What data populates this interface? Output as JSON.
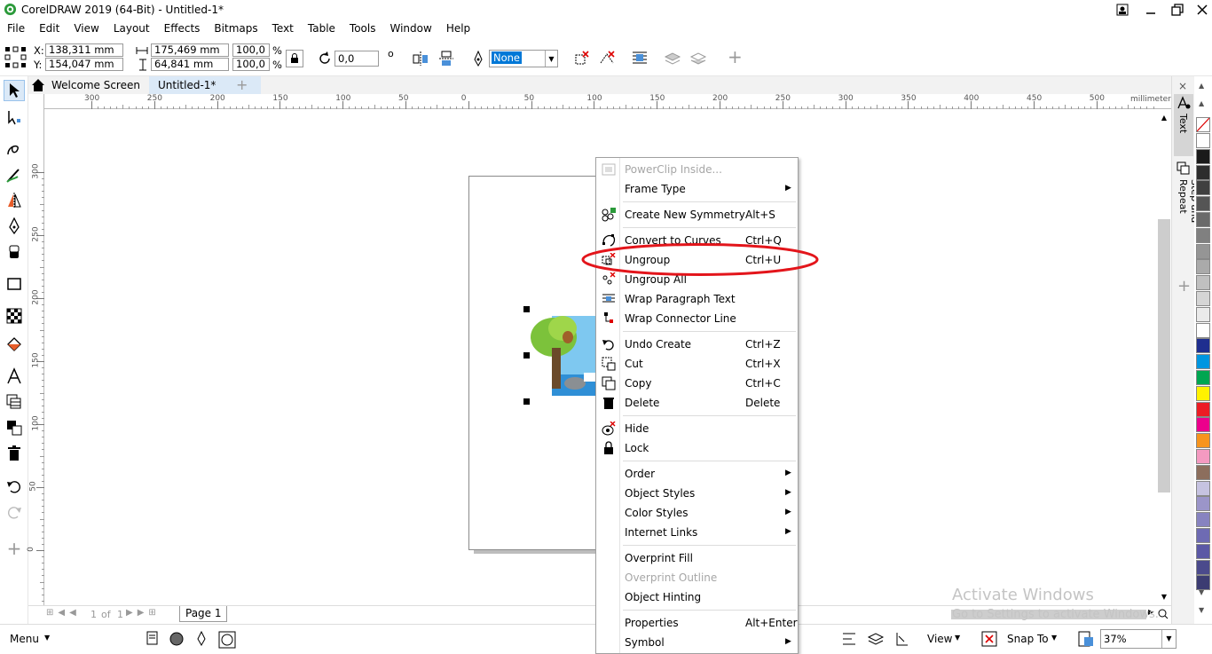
{
  "title_bar": {
    "title": "CorelDRAW 2019 (64-Bit) - Untitled-1*"
  },
  "menu": [
    "File",
    "Edit",
    "View",
    "Layout",
    "Effects",
    "Bitmaps",
    "Text",
    "Table",
    "Tools",
    "Window",
    "Help"
  ],
  "property_bar": {
    "x_label": "X:",
    "x_value": "138,311 mm",
    "y_label": "Y:",
    "y_value": "154,047 mm",
    "width_value": "175,469 mm",
    "height_value": "64,841 mm",
    "scale_x": "100,0",
    "scale_y": "100,0",
    "percent": "%",
    "rotation_value": "0,0",
    "degree": "o",
    "outline_value": "None"
  },
  "tabs": {
    "welcome": "Welcome Screen",
    "document": "Untitled-1*",
    "add": "+"
  },
  "rulers": {
    "h_ticks": [
      "300",
      "250",
      "200",
      "150",
      "100",
      "50",
      "0",
      "50",
      "100",
      "150",
      "200",
      "250",
      "300",
      "350",
      "400",
      "450",
      "500"
    ],
    "h_unit": "millimeters",
    "v_ticks": [
      "300",
      "250",
      "200",
      "150",
      "100",
      "50",
      "0"
    ]
  },
  "docker": {
    "text_tab": "Text",
    "step_tab": "Step and Repeat"
  },
  "palette_colors": [
    "#ffffff",
    "#1a1a1a",
    "#2d2d2d",
    "#404040",
    "#555555",
    "#6a6a6a",
    "#808080",
    "#959595",
    "#aaaaaa",
    "#c0c0c0",
    "#d5d5d5",
    "#eaeaea",
    "#ffffff",
    "#1f2e8f",
    "#0096e0",
    "#00a651",
    "#fff200",
    "#ec1c24",
    "#ec008c",
    "#f7941d",
    "#f49ac1",
    "#8c6e5d",
    "#c6c3e1",
    "#9b95c9",
    "#8783c0",
    "#6e6bb3",
    "#5b58a5",
    "#4b4a8c",
    "#3c3c72"
  ],
  "page_nav": {
    "of_text": "1",
    "of_label": "of",
    "total": "1",
    "page_tab": "Page 1"
  },
  "context_menu": [
    {
      "label": "PowerClip Inside...",
      "shortcut": "",
      "submenu": false,
      "disabled": true,
      "icon": "powerclip-icon"
    },
    {
      "label": "Frame Type",
      "shortcut": "",
      "submenu": true,
      "disabled": false,
      "icon": ""
    },
    {
      "sep": true
    },
    {
      "label": "Create New Symmetry",
      "shortcut": "Alt+S",
      "submenu": false,
      "disabled": false,
      "icon": "symmetry-icon"
    },
    {
      "sep": true
    },
    {
      "label": "Convert to Curves",
      "shortcut": "Ctrl+Q",
      "submenu": false,
      "disabled": false,
      "icon": "curves-icon"
    },
    {
      "label": "Ungroup",
      "shortcut": "Ctrl+U",
      "submenu": false,
      "disabled": false,
      "icon": "ungroup-icon"
    },
    {
      "label": "Ungroup All",
      "shortcut": "",
      "submenu": false,
      "disabled": false,
      "icon": "ungroup-all-icon"
    },
    {
      "label": "Wrap Paragraph Text",
      "shortcut": "",
      "submenu": false,
      "disabled": false,
      "icon": "wrap-text-icon"
    },
    {
      "label": "Wrap Connector Line",
      "shortcut": "",
      "submenu": false,
      "disabled": false,
      "icon": "connector-icon"
    },
    {
      "sep": true
    },
    {
      "label": "Undo Create",
      "shortcut": "Ctrl+Z",
      "submenu": false,
      "disabled": false,
      "icon": "undo-icon"
    },
    {
      "label": "Cut",
      "shortcut": "Ctrl+X",
      "submenu": false,
      "disabled": false,
      "icon": "cut-icon"
    },
    {
      "label": "Copy",
      "shortcut": "Ctrl+C",
      "submenu": false,
      "disabled": false,
      "icon": "copy-icon"
    },
    {
      "label": "Delete",
      "shortcut": "Delete",
      "submenu": false,
      "disabled": false,
      "icon": "trash-icon"
    },
    {
      "sep": true
    },
    {
      "label": "Hide",
      "shortcut": "",
      "submenu": false,
      "disabled": false,
      "icon": "hide-icon"
    },
    {
      "label": "Lock",
      "shortcut": "",
      "submenu": false,
      "disabled": false,
      "icon": "lock-icon"
    },
    {
      "sep": true
    },
    {
      "label": "Order",
      "shortcut": "",
      "submenu": true,
      "disabled": false,
      "icon": ""
    },
    {
      "label": "Object Styles",
      "shortcut": "",
      "submenu": true,
      "disabled": false,
      "icon": ""
    },
    {
      "label": "Color Styles",
      "shortcut": "",
      "submenu": true,
      "disabled": false,
      "icon": ""
    },
    {
      "label": "Internet Links",
      "shortcut": "",
      "submenu": true,
      "disabled": false,
      "icon": ""
    },
    {
      "sep": true
    },
    {
      "label": "Overprint Fill",
      "shortcut": "",
      "submenu": false,
      "disabled": false,
      "icon": ""
    },
    {
      "label": "Overprint Outline",
      "shortcut": "",
      "submenu": false,
      "disabled": true,
      "icon": ""
    },
    {
      "label": "Object Hinting",
      "shortcut": "",
      "submenu": false,
      "disabled": false,
      "icon": ""
    },
    {
      "sep": true
    },
    {
      "label": "Properties",
      "shortcut": "Alt+Enter",
      "submenu": false,
      "disabled": false,
      "icon": ""
    },
    {
      "label": "Symbol",
      "shortcut": "",
      "submenu": true,
      "disabled": false,
      "icon": ""
    }
  ],
  "status_bar": {
    "menu": "Menu",
    "view": "View",
    "snap_to": "Snap To",
    "zoom": "37%"
  },
  "watermark": {
    "line1": "Activate Windows",
    "line2": "Go to Settings to activate Windows."
  }
}
